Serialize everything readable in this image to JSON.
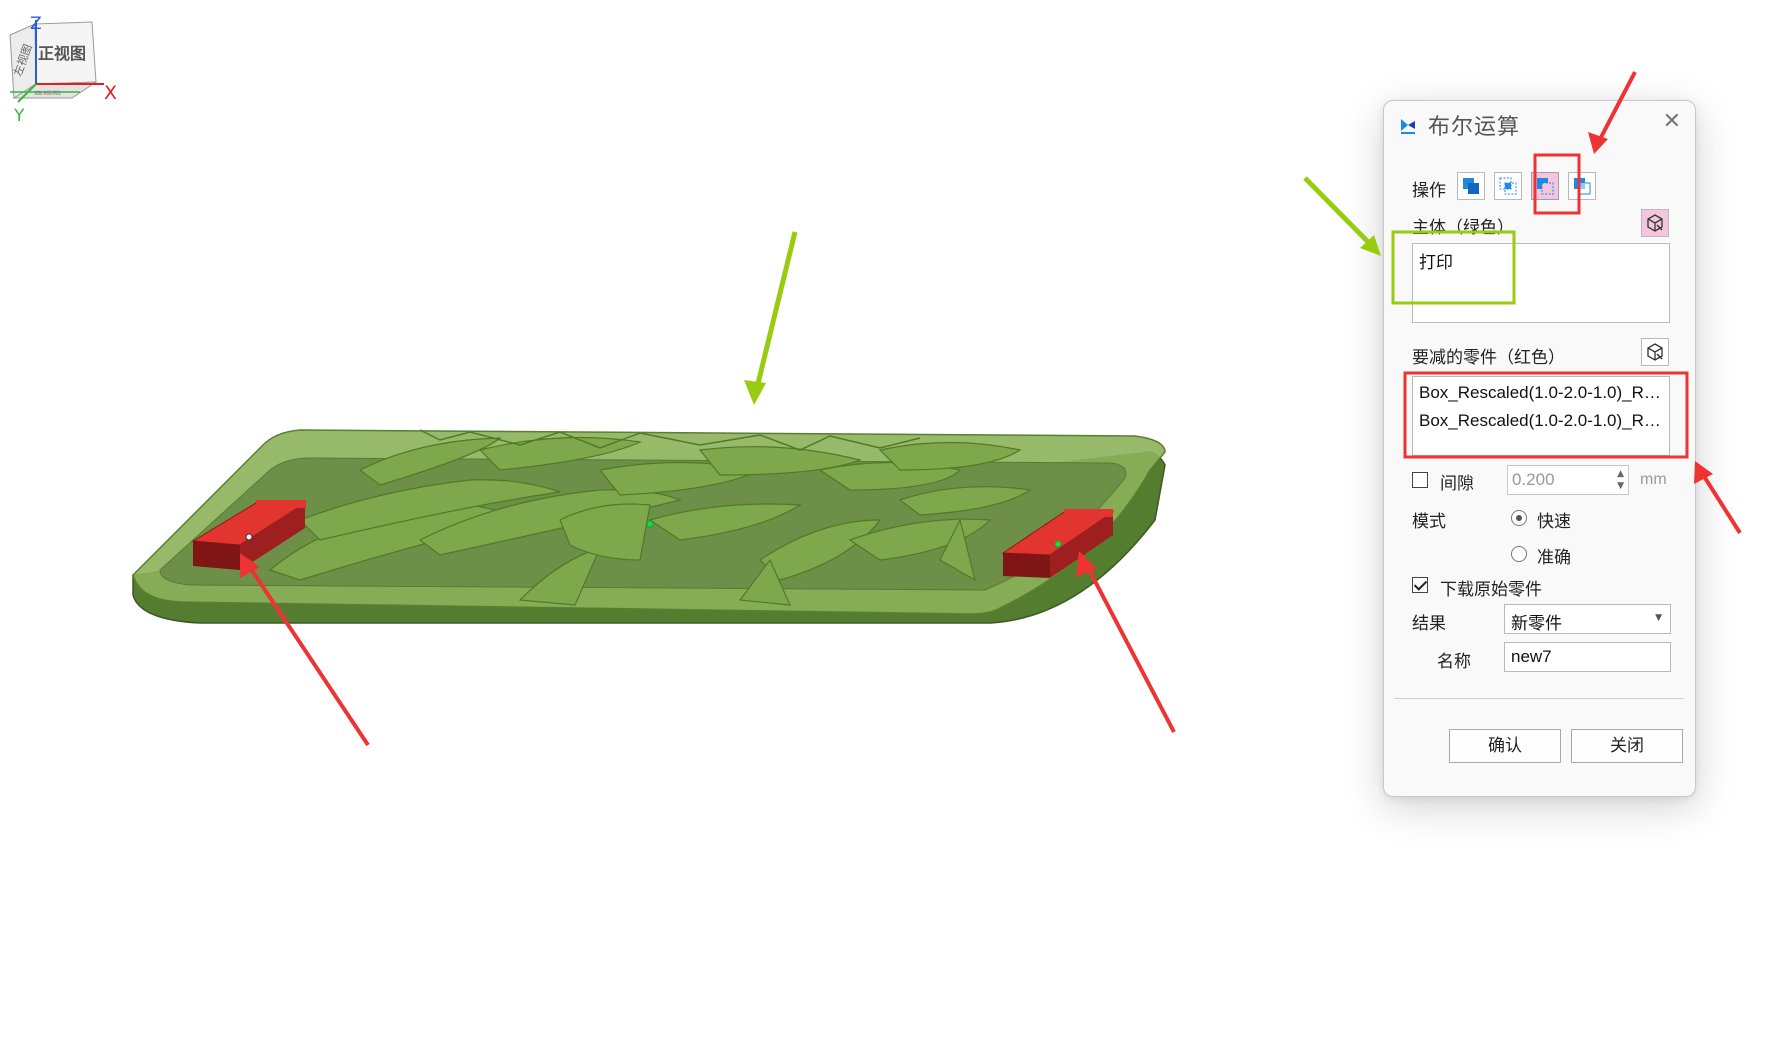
{
  "view_cube": {
    "front_label": "正视图",
    "left_label": "左视图",
    "bottom_label": "底视图",
    "axis_z": "Z",
    "axis_x": "X",
    "axis_y": "Y",
    "color_z": "#2a5bd7",
    "color_x": "#e02020",
    "color_y": "#3db53d"
  },
  "dialog": {
    "title": "布尔运算",
    "close_icon": "close-icon",
    "operation_label": "操作",
    "operations": [
      "union",
      "intersect",
      "subtract",
      "split"
    ],
    "active_operation": "subtract",
    "main_body_label": "主体（绿色）",
    "main_body_items": [
      "打印"
    ],
    "subtract_label": "要减的零件（红色）",
    "subtract_items": [
      "Box_Rescaled(1.0-2.0-1.0)_Re...",
      "Box_Rescaled(1.0-2.0-1.0)_Re..."
    ],
    "gap_label": "间隙",
    "gap_checked": false,
    "gap_value": "0.200",
    "gap_unit": "mm",
    "mode_label": "模式",
    "mode_options": [
      "快速",
      "准确"
    ],
    "mode_selected": "快速",
    "download_label": "下载原始零件",
    "download_checked": true,
    "result_label": "结果",
    "result_value": "新零件",
    "name_label": "名称",
    "name_value": "new7",
    "confirm_label": "确认",
    "close_label": "关闭"
  },
  "colors": {
    "accent_blue": "#1e88e5",
    "active_pink": "#f4c6dd",
    "annotation_red": "#ee3333",
    "annotation_green": "#99cc11",
    "model_green": "#6c9a3c",
    "cutter_red": "#8b1a1a"
  }
}
